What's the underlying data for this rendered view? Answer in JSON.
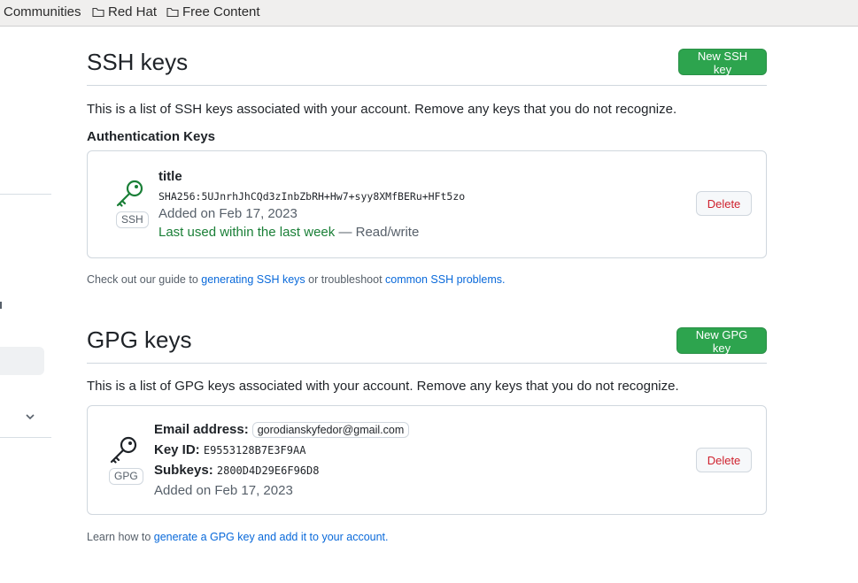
{
  "bookmarks": [
    {
      "label": "Communities",
      "icon": "folder-icon"
    },
    {
      "label": "Red Hat",
      "icon": "folder-icon"
    },
    {
      "label": "Free Content",
      "icon": "folder-icon"
    }
  ],
  "ssh": {
    "title": "SSH keys",
    "new_button": "New SSH key",
    "description": "This is a list of SSH keys associated with your account. Remove any keys that you do not recognize.",
    "subheading": "Authentication Keys",
    "key": {
      "badge": "SSH",
      "title": "title",
      "fingerprint": "SHA256:5UJnrhJhCQd3zInbZbRH+Hw7+syy8XMfBERu+HFt5zo",
      "added": "Added on Feb 17, 2023",
      "last_used": "Last used within the last week",
      "access": " — Read/write",
      "delete_label": "Delete"
    },
    "footer": {
      "prefix": "Check out our guide to ",
      "link1": "generating SSH keys",
      "middle": " or troubleshoot ",
      "link2": "common SSH problems",
      "suffix": "."
    }
  },
  "gpg": {
    "title": "GPG keys",
    "new_button": "New GPG key",
    "description": "This is a list of GPG keys associated with your account. Remove any keys that you do not recognize.",
    "key": {
      "badge": "GPG",
      "email_label": "Email address:",
      "email": "gorodianskyfedor@gmail.com",
      "keyid_label": "Key ID:",
      "keyid": "E9553128B7E3F9AA",
      "subkeys_label": "Subkeys:",
      "subkeys": "2800D4D29E6F96D8",
      "added": "Added on Feb 17, 2023",
      "delete_label": "Delete"
    },
    "footer": {
      "prefix": "Learn how to ",
      "link": "generate a GPG key and add it to your account",
      "suffix": "."
    }
  },
  "colors": {
    "primary_button": "#2da44e",
    "danger": "#cf222e",
    "link": "#0969da",
    "recent_use": "#1a7f37"
  }
}
